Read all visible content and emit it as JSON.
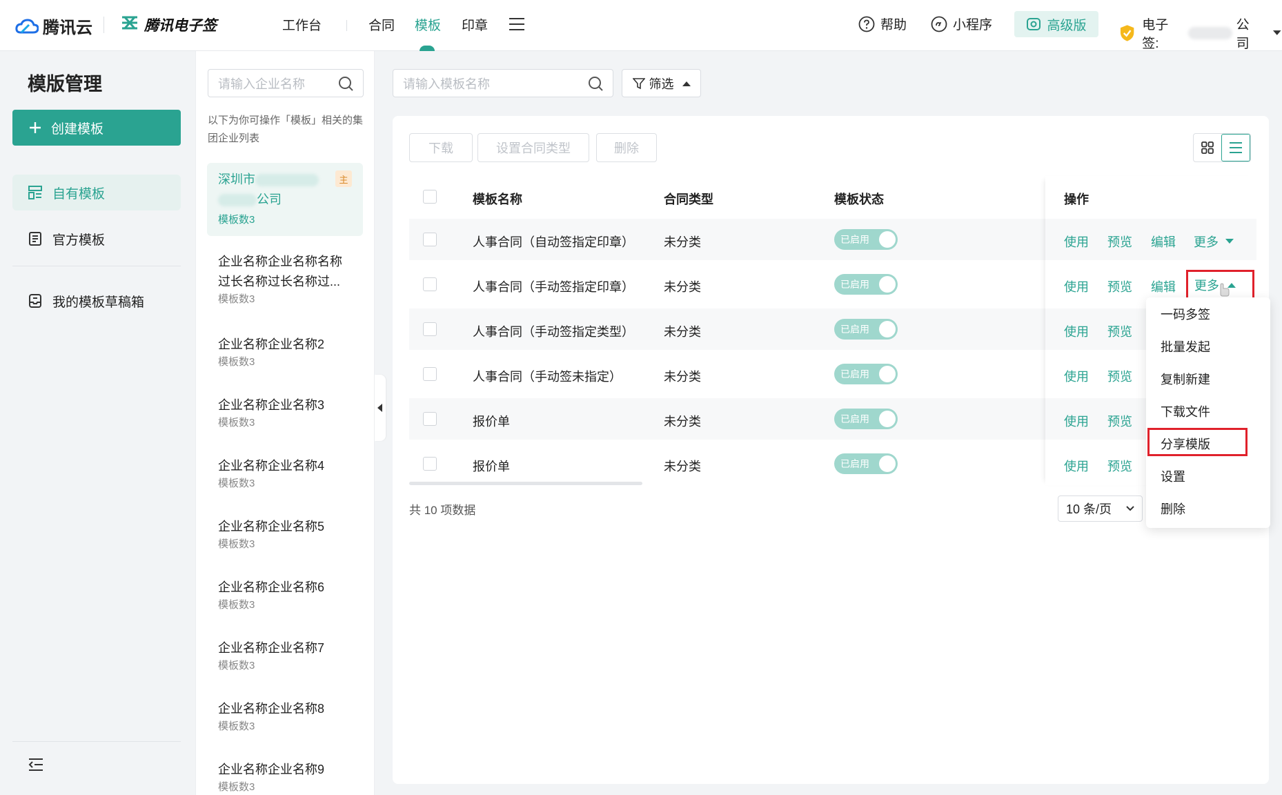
{
  "header": {
    "brand": "腾讯云",
    "product": "腾讯电子签",
    "nav": [
      "工作台",
      "合同",
      "模板",
      "印章"
    ],
    "active_nav": "模板",
    "help": "帮助",
    "mini_program": "小程序",
    "edition": "高级版",
    "account_prefix": "电子签:",
    "account_suffix": "公司"
  },
  "sidebar": {
    "title": "模版管理",
    "create_label": "创建模板",
    "items": [
      {
        "label": "自有模板",
        "icon": "template-list-icon"
      },
      {
        "label": "官方模板",
        "icon": "official-template-icon"
      },
      {
        "label": "我的模板草稿箱",
        "icon": "draft-box-icon"
      }
    ]
  },
  "company_panel": {
    "search_placeholder": "请输入企业名称",
    "hint": "以下为你可操作「模板」相关的集团企业列表",
    "main_tag": "主",
    "companies": [
      {
        "name_line1": "深圳市",
        "name_line2": "公司",
        "count": "模板数3"
      },
      {
        "name_line1": "企业名称企业名称名称",
        "name_line2": "过长名称过长名称过...",
        "count": "模板数3"
      },
      {
        "name_line1": "企业名称企业名称2",
        "count": "模板数3"
      },
      {
        "name_line1": "企业名称企业名称3",
        "count": "模板数3"
      },
      {
        "name_line1": "企业名称企业名称4",
        "count": "模板数3"
      },
      {
        "name_line1": "企业名称企业名称5",
        "count": "模板数3"
      },
      {
        "name_line1": "企业名称企业名称6",
        "count": "模板数3"
      },
      {
        "name_line1": "企业名称企业名称7",
        "count": "模板数3"
      },
      {
        "name_line1": "企业名称企业名称8",
        "count": "模板数3"
      },
      {
        "name_line1": "企业名称企业名称9",
        "count": "模板数3"
      }
    ]
  },
  "main": {
    "search_placeholder": "请输入模板名称",
    "filter_label": "筛选",
    "bulk_actions": [
      "下载",
      "设置合同类型",
      "删除"
    ],
    "columns": {
      "name": "模板名称",
      "type": "合同类型",
      "status": "模板状态",
      "ops": "操作"
    },
    "rows": [
      {
        "name": "人事合同（自动签指定印章）",
        "type": "未分类",
        "status": "已启用"
      },
      {
        "name": "人事合同（手动签指定印章）",
        "type": "未分类",
        "status": "已启用"
      },
      {
        "name": "人事合同（手动签指定类型）",
        "type": "未分类",
        "status": "已启用"
      },
      {
        "name": "人事合同（手动签未指定）",
        "type": "未分类",
        "status": "已启用"
      },
      {
        "name": "报价单",
        "type": "未分类",
        "status": "已启用"
      },
      {
        "name": "报价单",
        "type": "未分类",
        "status": "已启用"
      }
    ],
    "ops": {
      "use": "使用",
      "preview": "预览",
      "edit": "编辑",
      "more": "更多"
    },
    "total": "共 10 项数据",
    "page_size": "10 条/页",
    "more_menu": [
      "一码多签",
      "批量发起",
      "复制新建",
      "下载文件",
      "分享模版",
      "设置",
      "删除"
    ]
  },
  "colors": {
    "accent": "#2aa391",
    "highlight": "#e0212b"
  }
}
